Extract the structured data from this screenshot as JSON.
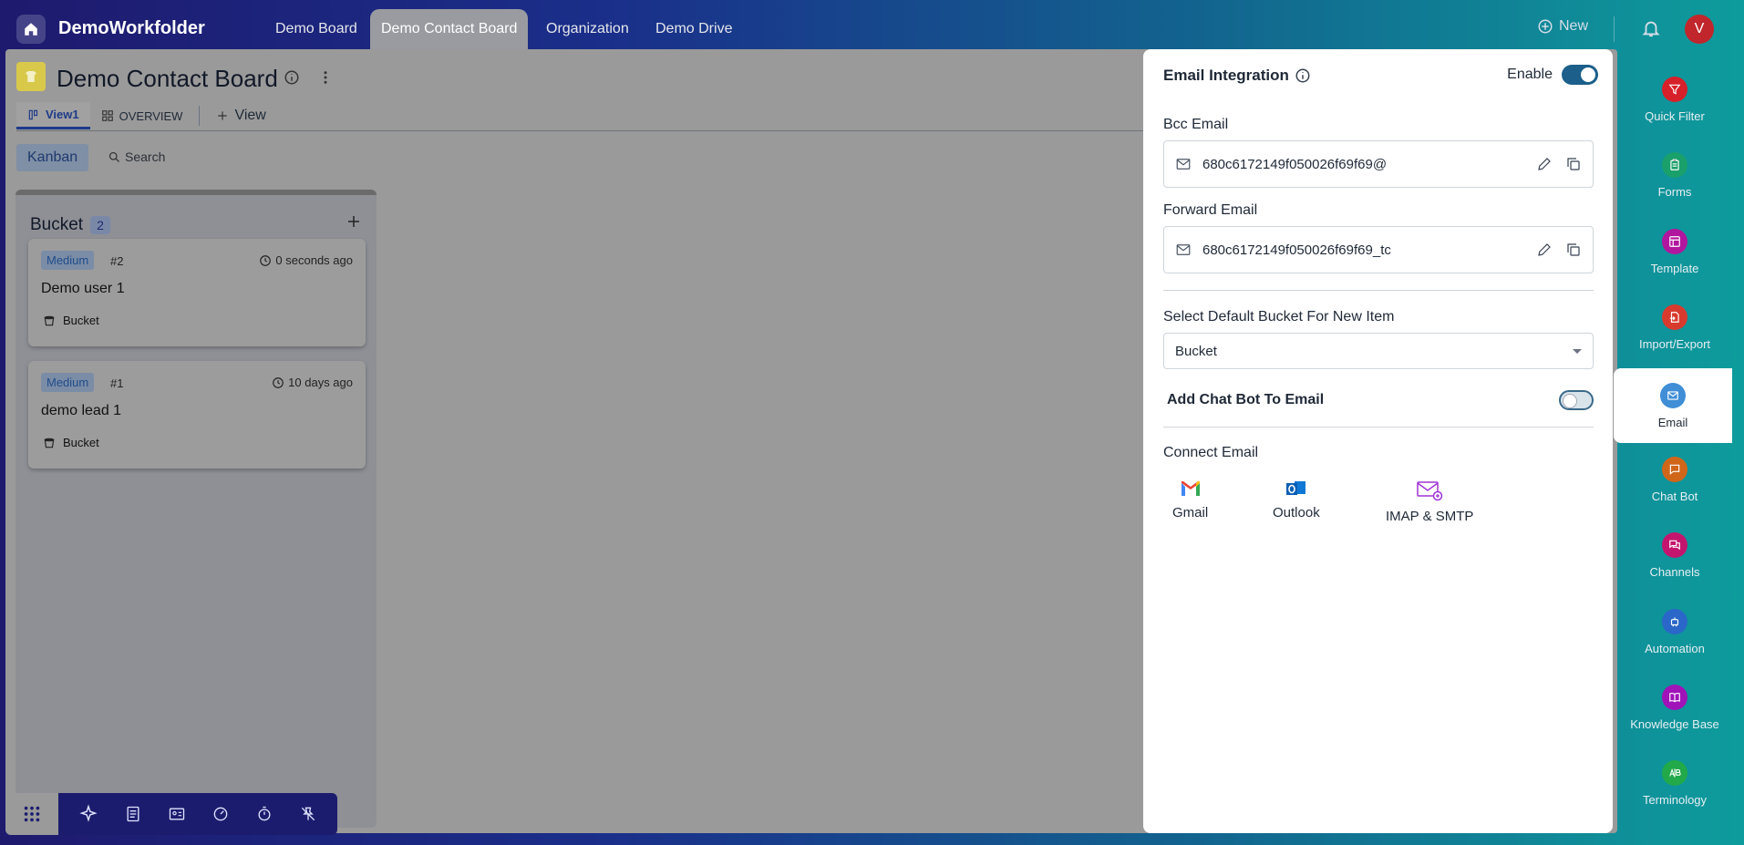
{
  "app": {
    "title": "DemoWorkfolder"
  },
  "top_tabs": [
    {
      "label": "Demo Board"
    },
    {
      "label": "Demo Contact Board"
    },
    {
      "label": "Organization"
    },
    {
      "label": "Demo Drive"
    }
  ],
  "top_right": {
    "new_label": "New",
    "avatar_initial": "V"
  },
  "board": {
    "title": "Demo Contact Board",
    "view_tabs": [
      {
        "label": "View1"
      },
      {
        "label": "OVERVIEW"
      },
      {
        "label": "View"
      }
    ],
    "kanban_label": "Kanban",
    "search_label": "Search",
    "bucket": {
      "name": "Bucket",
      "count": "2",
      "cards": [
        {
          "priority": "Medium",
          "number": "#2",
          "time": "0 seconds ago",
          "name": "Demo user 1",
          "bucket": "Bucket"
        },
        {
          "priority": "Medium",
          "number": "#1",
          "time": "10 days ago",
          "name": "demo lead 1",
          "bucket": "Bucket"
        }
      ]
    }
  },
  "email_panel": {
    "title": "Email Integration",
    "enable_label": "Enable",
    "enabled": true,
    "bcc_label": "Bcc Email",
    "bcc_value": "680c6172149f050026f69f69@",
    "forward_label": "Forward Email",
    "forward_value": "680c6172149f050026f69f69_tc",
    "default_bucket_label": "Select Default Bucket For New Item",
    "default_bucket_value": "Bucket",
    "chatbot_label": "Add Chat Bot To Email",
    "chatbot_enabled": false,
    "connect_title": "Connect Email",
    "providers": [
      {
        "label": "Gmail"
      },
      {
        "label": "Outlook"
      },
      {
        "label": "IMAP & SMTP"
      }
    ]
  },
  "sidebar": {
    "items": [
      {
        "label": "Quick Filter",
        "color": "#d6202a"
      },
      {
        "label": "Forms",
        "color": "#1aa06a"
      },
      {
        "label": "Template",
        "color": "#b1169e"
      },
      {
        "label": "Import/Export",
        "color": "#d83a2e"
      },
      {
        "label": "Email",
        "color": "#3f8ed6"
      },
      {
        "label": "Chat Bot",
        "color": "#d0661a"
      },
      {
        "label": "Channels",
        "color": "#c4156e"
      },
      {
        "label": "Automation",
        "color": "#2a67c9"
      },
      {
        "label": "Knowledge Base",
        "color": "#9f13b8"
      },
      {
        "label": "Terminology",
        "color": "#22a94a"
      }
    ]
  }
}
